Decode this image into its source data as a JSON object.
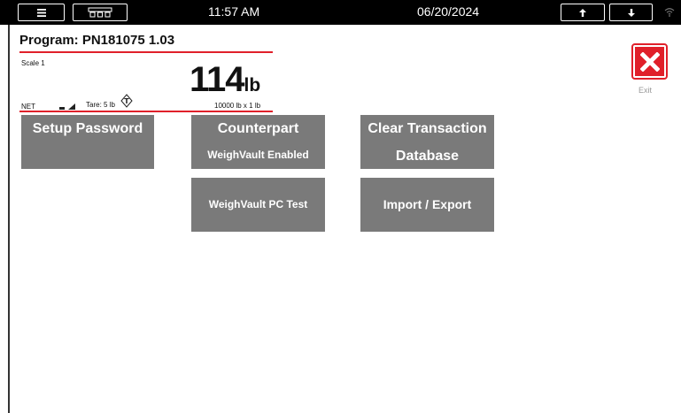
{
  "topbar": {
    "menu_icon": "hamburger-menu-icon",
    "scale_icon": "scale-select-icon",
    "time": "11:57 AM",
    "date": "06/20/2024",
    "up_icon": "arrow-up-icon",
    "down_icon": "arrow-down-icon",
    "wifi_icon": "wifi-icon"
  },
  "header": {
    "program": "Program: PN181075 1.03",
    "scale_name": "Scale 1",
    "weight_value": "114",
    "weight_unit": "lb",
    "mode": "NET",
    "tare": "Tare: 5 lb",
    "capacity": "10000 lb x 1 lb",
    "accent_color": "#e0202a"
  },
  "tiles": {
    "setup_password": "Setup Password",
    "counterpart_title": "Counterpart",
    "counterpart_sub": "WeighVault Enabled",
    "clear_line1": "Clear Transaction",
    "clear_line2": "Database",
    "pc_test": "WeighVault PC Test",
    "import_export": "Import / Export",
    "tile_color": "#7a7a7a"
  },
  "exit": {
    "label": "Exit",
    "icon": "close-icon"
  }
}
